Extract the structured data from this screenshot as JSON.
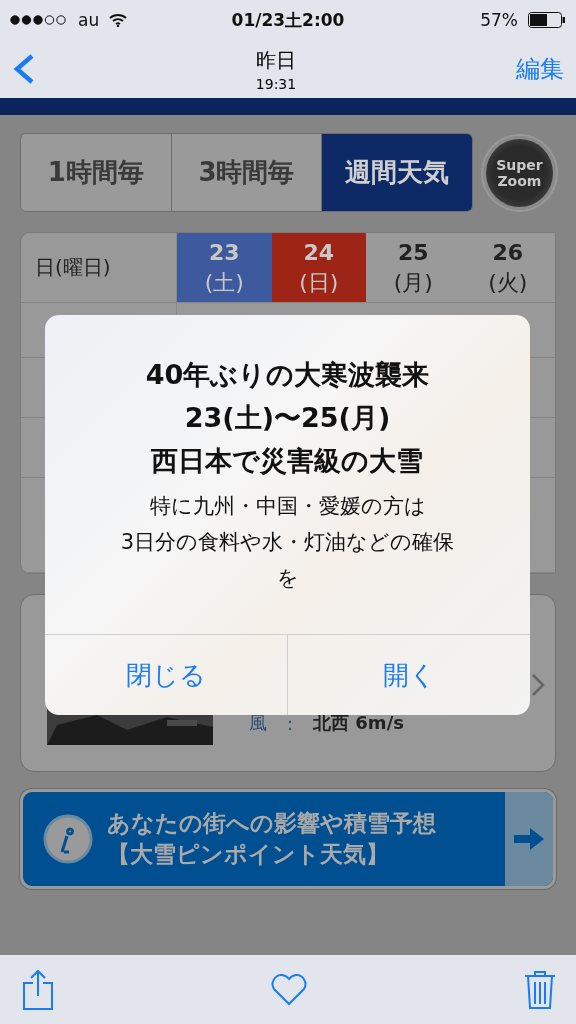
{
  "status_bar": {
    "carrier": "au",
    "time": "01/23土2:00",
    "battery": "57%"
  },
  "nav": {
    "title": "昨日",
    "subtitle": "19:31",
    "edit": "編集"
  },
  "tabs": [
    {
      "label": "1時間毎",
      "selected": false
    },
    {
      "label": "3時間毎",
      "selected": false
    },
    {
      "label": "週間天気",
      "selected": true
    }
  ],
  "zoom_button": {
    "line1": "Super",
    "line2": "Zoom"
  },
  "table": {
    "header_label": "日(曜日)",
    "days": [
      {
        "date": "23",
        "weekday": "(土)",
        "color": "#3e5a9e"
      },
      {
        "date": "24",
        "weekday": "(日)",
        "color": "#9e2416"
      },
      {
        "date": "25",
        "weekday": "(月)",
        "color": "#9a9a9a"
      },
      {
        "date": "26",
        "weekday": "(火)",
        "color": "#9a9a9a"
      }
    ]
  },
  "card": {
    "wind_label": "風",
    "separator": ":",
    "wind_value": "北西 6m/s"
  },
  "banner": {
    "lines": [
      "あなたの街への影響や積雪予想",
      "【大雪ピンポイント天気】"
    ]
  },
  "alert": {
    "title_lines": [
      "40年ぶりの大寒波襲来",
      "23(土)〜25(月)",
      "西日本で災害級の大雪"
    ],
    "message_lines": [
      "特に九州・中国・愛媛の方は",
      "3日分の食料や水・灯油などの確保",
      "を"
    ],
    "buttons": [
      "閉じる",
      "開く"
    ]
  }
}
